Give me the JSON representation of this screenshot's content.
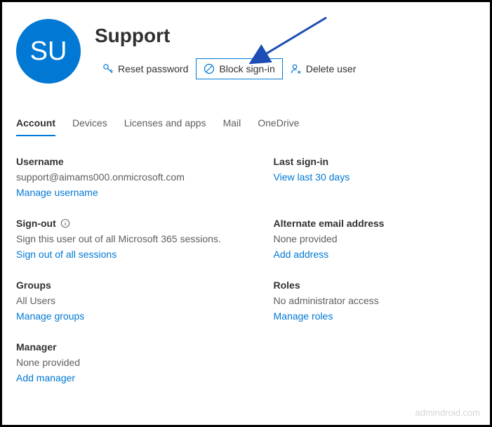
{
  "avatar": {
    "initials": "SU",
    "color": "#0078d4"
  },
  "title": "Support",
  "actions": {
    "reset": "Reset password",
    "block": "Block sign-in",
    "delete": "Delete user"
  },
  "tabs": [
    "Account",
    "Devices",
    "Licenses and apps",
    "Mail",
    "OneDrive"
  ],
  "sections": {
    "username": {
      "label": "Username",
      "value": "support@aimams000.onmicrosoft.com",
      "link": "Manage username"
    },
    "signin": {
      "label": "Last sign-in",
      "link": "View last 30 days"
    },
    "signout": {
      "label": "Sign-out",
      "value": "Sign this user out of all Microsoft 365 sessions.",
      "link": "Sign out of all sessions"
    },
    "altemail": {
      "label": "Alternate email address",
      "value": "None provided",
      "link": "Add address"
    },
    "groups": {
      "label": "Groups",
      "value": "All Users",
      "link": "Manage groups"
    },
    "roles": {
      "label": "Roles",
      "value": "No administrator access",
      "link": "Manage roles"
    },
    "manager": {
      "label": "Manager",
      "value": "None provided",
      "link": "Add manager"
    }
  },
  "watermark": "admindroid.com"
}
